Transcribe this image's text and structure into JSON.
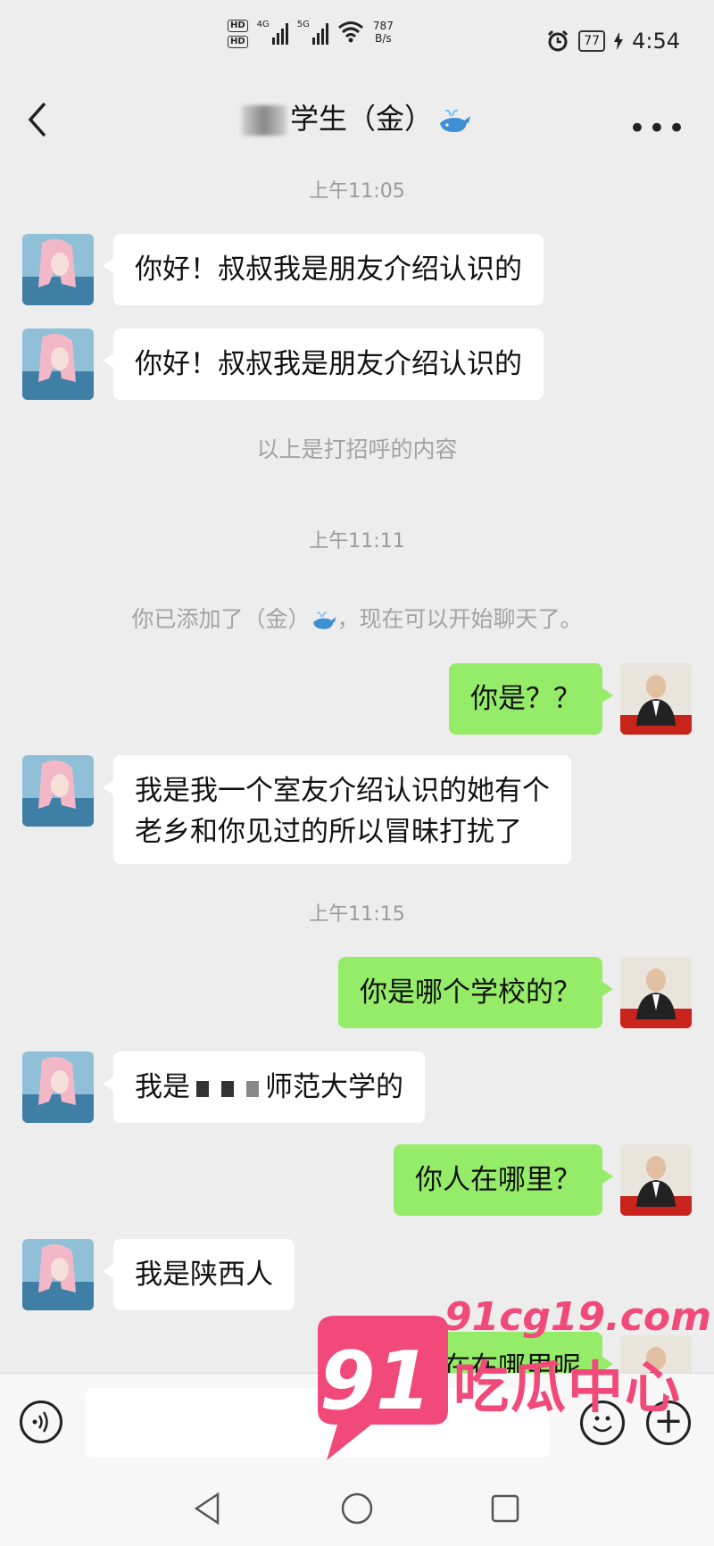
{
  "status_bar": {
    "hd1": "HD",
    "hd2": "HD",
    "sig1": "4G",
    "sig2": "5G",
    "speed_value": "787",
    "speed_unit": "B/s",
    "battery": "77",
    "time": "4:54"
  },
  "header": {
    "title": "学生（金）"
  },
  "messages": {
    "t1": "上午11:05",
    "m1": "你好！叔叔我是朋友介绍认识的",
    "m2": "你好！叔叔我是朋友介绍认识的",
    "sys1": "以上是打招呼的内容",
    "t2": "上午11:11",
    "sys2_a": "你已添加了（金）",
    "sys2_b": "，现在可以开始聊天了。",
    "m3": "你是？？",
    "m4_l1": "我是我一个室友介绍认识的她有个",
    "m4_l2": "老乡和你见过的所以冒昧打扰了",
    "t3": "上午11:15",
    "m5": "你是哪个学校的？",
    "m6_a": "我是",
    "m6_b": "师范大学的",
    "m7": "你人在哪里？",
    "m8": "我是陕西人",
    "m9": "现在在哪里呢"
  },
  "watermark": {
    "num": "91",
    "url": "91cg19.com",
    "cn": "吃瓜中心"
  },
  "colors": {
    "background": "#ededed",
    "bubble_right": "#95ec69",
    "bubble_left": "#ffffff",
    "watermark_pink": "#f1497a"
  },
  "icons": [
    "back-icon",
    "more-icon",
    "whale-icon",
    "voice-icon",
    "emoji-icon",
    "plus-icon",
    "nav-back-icon",
    "nav-home-icon",
    "nav-recent-icon",
    "wifi-icon",
    "alarm-icon",
    "charging-icon"
  ]
}
